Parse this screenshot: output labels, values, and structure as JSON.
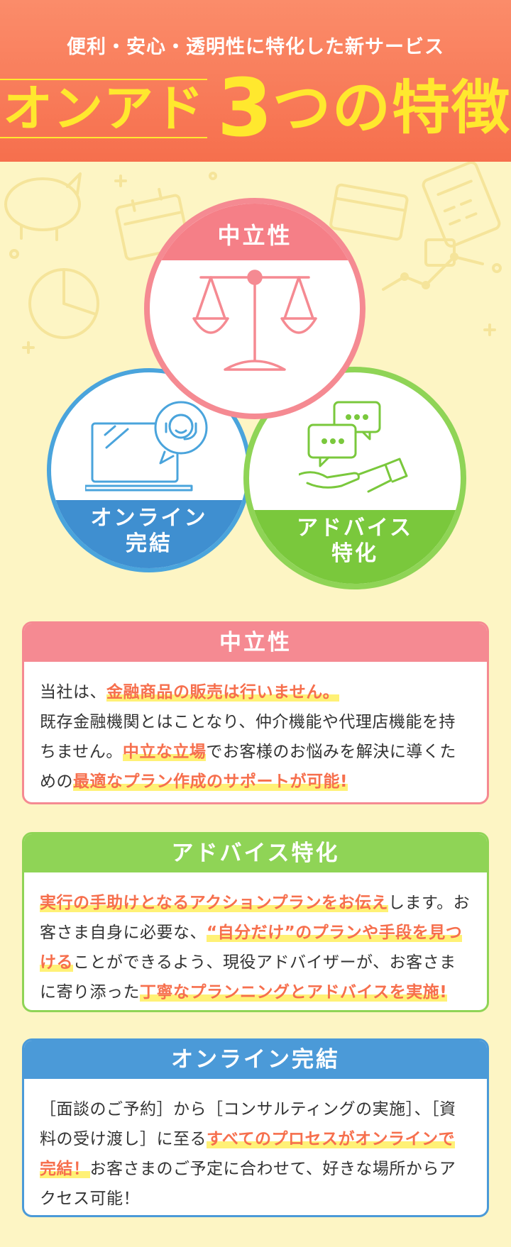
{
  "header": {
    "subtitle": "便利・安心・透明性に特化した新サービス",
    "brand": "オンアド",
    "number": "3",
    "title_rest": "つの特徴"
  },
  "circles": {
    "neutral": {
      "label": "中立性"
    },
    "online": {
      "line1": "オンライン",
      "line2": "完結"
    },
    "advice": {
      "line1": "アドバイス",
      "line2": "特化"
    }
  },
  "cards": {
    "neutral": {
      "title": "中立性",
      "t1": "当社は、",
      "h1": "金融商品の販売は行いません。",
      "t2": "既存金融機関とはことなり、仲介機能や代理店機能を持ちません。",
      "h2": "中立な立場",
      "t3": "でお客様のお悩みを解決に導くための",
      "h3": "最適なプラン作成のサポートが可能!"
    },
    "advice": {
      "title": "アドバイス特化",
      "h1": "実行の手助けとなるアクションプランをお伝え",
      "t1": "します。お客さま自身に必要な、",
      "h2": "“自分だけ”のプランや手段を見つける",
      "t2": "ことができるよう、現役アドバイザーが、お客さまに寄り添った",
      "h3": "丁寧なプランニングとアドバイスを実施!"
    },
    "online": {
      "title": "オンライン完結",
      "t1": "［面談のご予約］から［コンサルティングの実施］、［資料の受け渡し］に至る",
      "h1": "すべてのプロセスがオンラインで完結！",
      "t2": "お客さまのご予定に合わせて、好きな場所からアクセス可能！"
    }
  },
  "colors": {
    "header": "#f66f4d",
    "title_yellow": "#ffe82e",
    "background": "#fdf5c4",
    "neutral": "#f58a92",
    "advice": "#8fd456",
    "online": "#4b9ad8",
    "highlight_text": "#f66f4d",
    "highlight_marker": "#fff176"
  },
  "icons": {
    "neutral": "balance-scale-icon",
    "online": "laptop-operator-icon",
    "advice": "chat-hand-icon"
  }
}
